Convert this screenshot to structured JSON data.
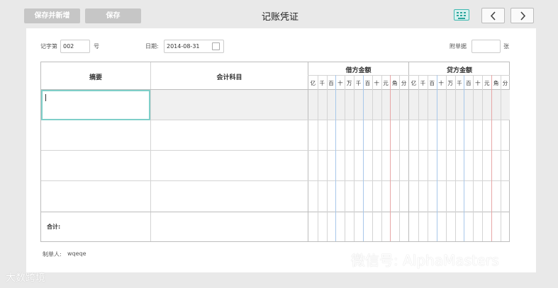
{
  "toolbar": {
    "save_and_new_label": "保存并新增",
    "save_label": "保存",
    "title": "记账凭证"
  },
  "voucher_header": {
    "voucher_no_label": "记字第",
    "voucher_no_value": "002",
    "voucher_no_suffix": "号",
    "date_label": "日期:",
    "date_value": "2014-08-31",
    "attachments_label": "附单据",
    "attachments_value": "",
    "attachments_suffix": "张"
  },
  "table": {
    "col_summary": "摘要",
    "col_account": "会计科目",
    "col_debit": "借方金额",
    "col_credit": "贷方金额",
    "digits": [
      "亿",
      "千",
      "百",
      "十",
      "万",
      "千",
      "百",
      "十",
      "元",
      "角",
      "分"
    ],
    "total_label": "合计:"
  },
  "footer": {
    "preparer_label": "制单人:",
    "preparer_value": "wqeqe"
  },
  "watermark": {
    "text": "微信号: AlphaMasters",
    "logo_text": "大数跨境"
  },
  "colors": {
    "accent": "#3fb9b0",
    "button_gray": "#c6c6c6",
    "grid_line": "#d4d4d4",
    "yuan_line": "#e7a6a6",
    "thousand_line": "#a8c8ea"
  }
}
